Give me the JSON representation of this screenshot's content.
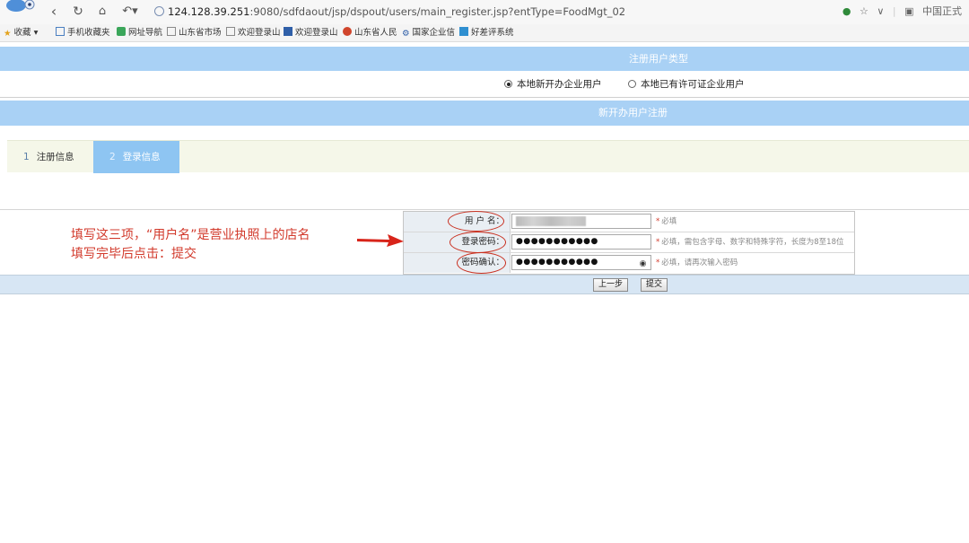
{
  "browser": {
    "address_host": "124.128.39.251",
    "address_rest": ":9080/sdfdaout/jsp/dspout/users/main_register.jsp?entType=FoodMgt_02",
    "right_label": "中国正式"
  },
  "bookmarks": [
    {
      "label": "收藏",
      "icon": "star-icon",
      "color": "#e3a21a"
    },
    {
      "label": "手机收藏夹",
      "icon": "phone-icon",
      "color": "#4a7fc1"
    },
    {
      "label": "网址导航",
      "icon": "navigation-icon",
      "color": "#3aa65a"
    },
    {
      "label": "山东省市场",
      "icon": "page-icon",
      "color": "#8a8a8a"
    },
    {
      "label": "欢迎登录山",
      "icon": "page-icon",
      "color": "#8a8a8a"
    },
    {
      "label": "欢迎登录山",
      "icon": "site-icon",
      "color": "#2f5fa8"
    },
    {
      "label": "山东省人民",
      "icon": "emblem-icon",
      "color": "#d0452c"
    },
    {
      "label": "国家企业信",
      "icon": "gear-icon",
      "color": "#2f5fa8"
    },
    {
      "label": "好差评系统",
      "icon": "site-icon",
      "color": "#2f8fd0"
    }
  ],
  "registration_type": {
    "title": "注册用户类型",
    "options": [
      {
        "label": "本地新开办企业用户",
        "selected": true
      },
      {
        "label": "本地已有许可证企业用户",
        "selected": false
      }
    ]
  },
  "new_registration": {
    "title": "新开办用户注册"
  },
  "steps": [
    {
      "num": "1",
      "label": "注册信息",
      "active": false
    },
    {
      "num": "2",
      "label": "登录信息",
      "active": true
    }
  ],
  "form": {
    "username": {
      "label": "用 户 名：",
      "hint": "必填"
    },
    "password": {
      "label": "登录密码：",
      "value": "●●●●●●●●●●●",
      "hint": "必填，需包含字母、数字和特殊字符，长度为8至18位"
    },
    "confirm": {
      "label": "密码确认：",
      "value": "●●●●●●●●●●●",
      "hint": "必填，请再次输入密码"
    },
    "required_mark": "*"
  },
  "buttons": {
    "prev": "上一步",
    "submit": "提交"
  },
  "annotation": {
    "line1": "填写这三项，“用户名”是营业执照上的店名",
    "line2": "填写完毕后点击：提交"
  },
  "colors": {
    "header_bar": "#a9d1f5",
    "active_step": "#8ec5f2",
    "annotation": "#d23a2c"
  }
}
